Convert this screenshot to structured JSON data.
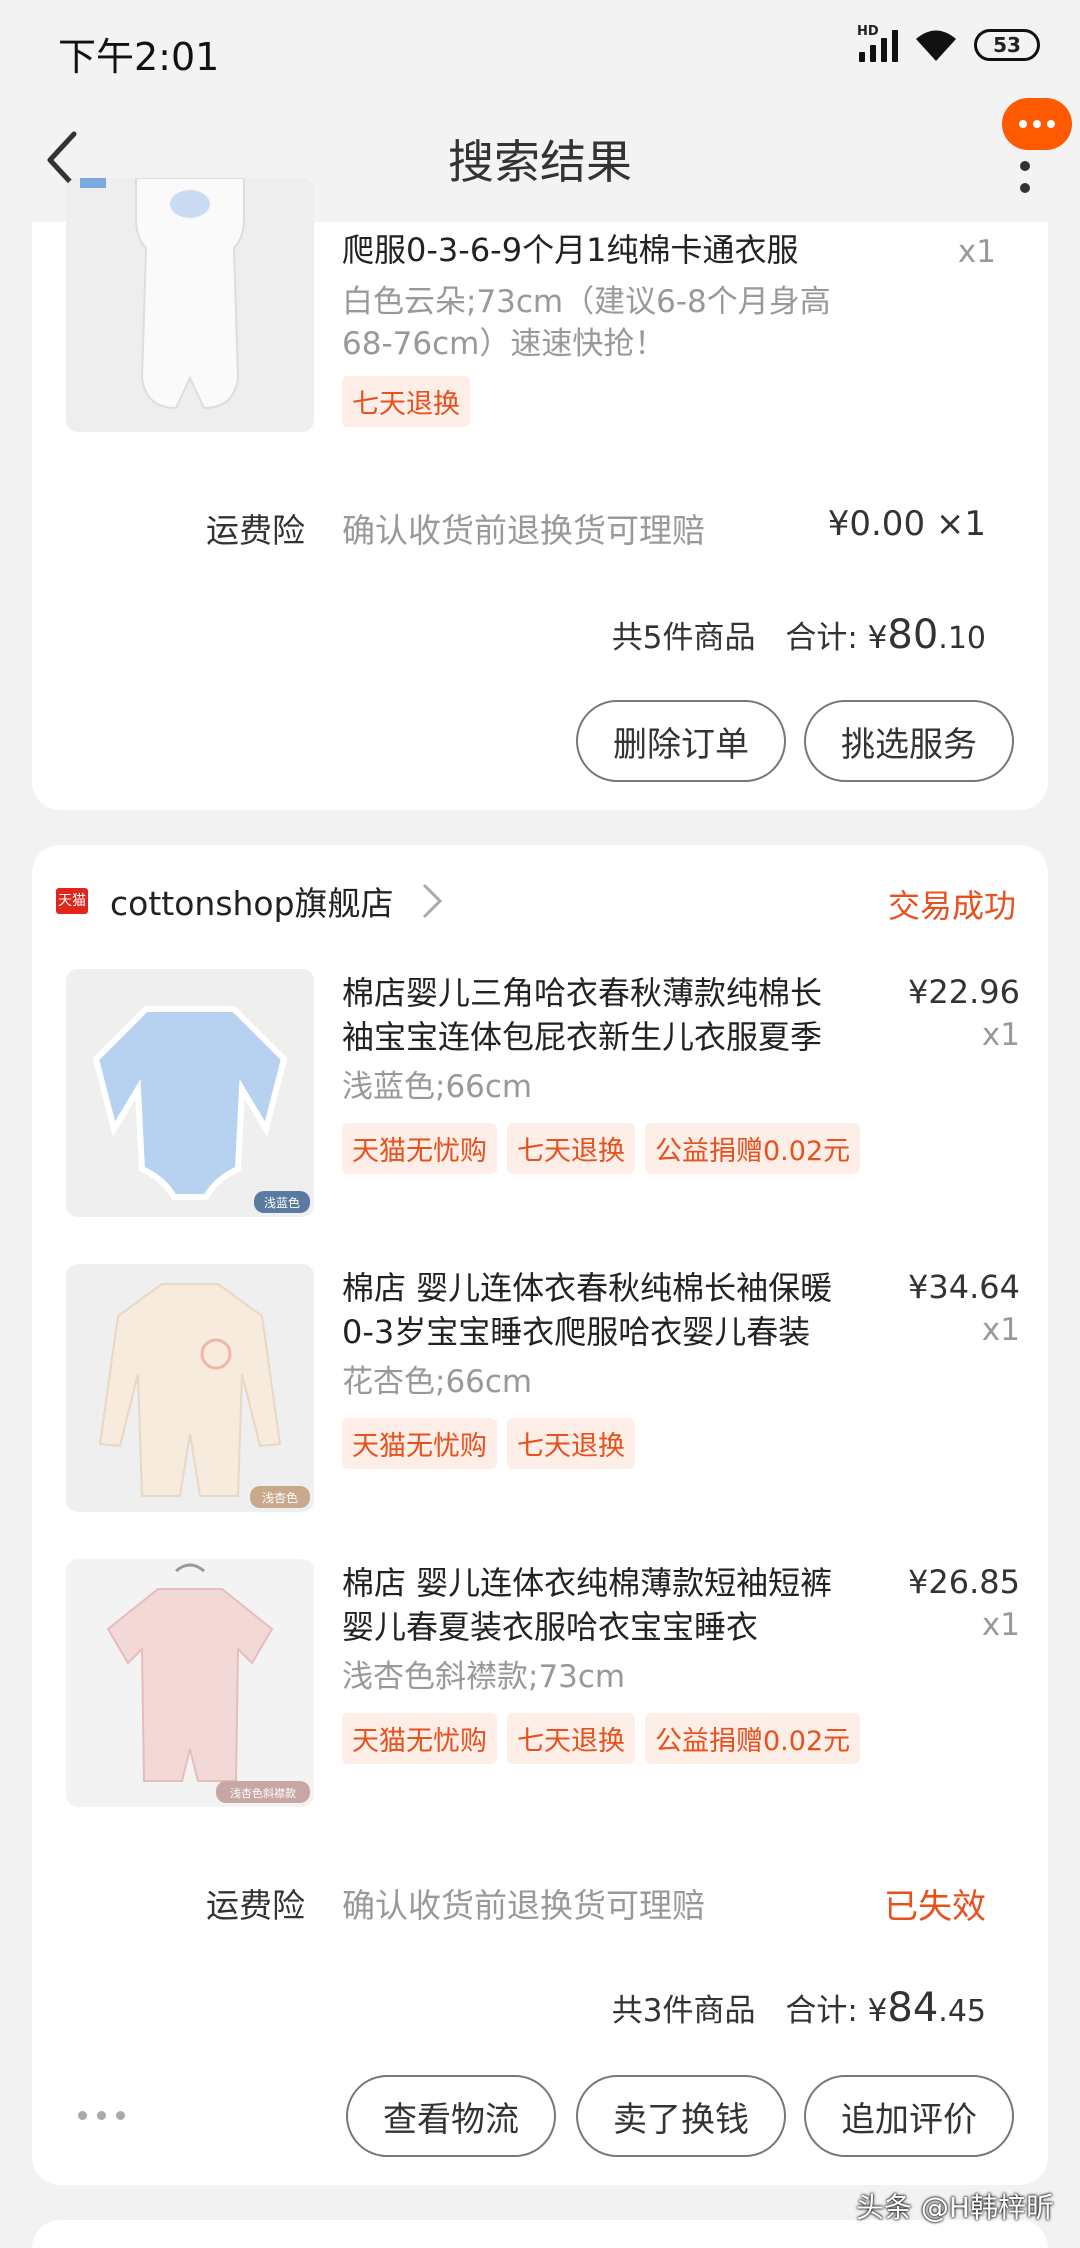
{
  "status_bar": {
    "time": "下午2:01",
    "battery": "53",
    "network": "HD"
  },
  "nav": {
    "title": "搜索结果"
  },
  "order1": {
    "item": {
      "title": "爬服0-3-6-9个月1纯棉卡通衣服",
      "spec_line1": "白色云朵;73cm（建议6-8个月身高",
      "spec_line2": "68-76cm）速速快抢！",
      "qty": "x1",
      "tags": [
        "七天退换"
      ]
    },
    "insurance": {
      "label": "运费险",
      "desc": "确认收货前退换货可理赔",
      "value": "¥0.00 ×1"
    },
    "summary": {
      "count": "共5件商品",
      "total_label": "合计:",
      "currency": "¥",
      "integer": "80",
      "decimal": ".10"
    },
    "buttons": [
      "删除订单",
      "挑选服务"
    ]
  },
  "order2": {
    "shop": {
      "badge": "天猫",
      "name": "cottonshop旗舰店",
      "status": "交易成功"
    },
    "items": [
      {
        "title_line1": "棉店婴儿三角哈衣春秋薄款纯棉长",
        "title_line2": "袖宝宝连体包屁衣新生儿衣服夏季",
        "spec": "浅蓝色;66cm",
        "price": "¥22.96",
        "qty": "x1",
        "tags": [
          "天猫无忧购",
          "七天退换",
          "公益捐赠0.02元"
        ],
        "thumb_label": "浅蓝色",
        "color": "#a9c8ee"
      },
      {
        "title_line1": "棉店 婴儿连体衣春秋纯棉长袖保暖",
        "title_line2": "0-3岁宝宝睡衣爬服哈衣婴儿春装",
        "spec": "花杏色;66cm",
        "price": "¥34.64",
        "qty": "x1",
        "tags": [
          "天猫无忧购",
          "七天退换"
        ],
        "thumb_label": "浅杏色",
        "color": "#f3e3d3"
      },
      {
        "title_line1": "棉店 婴儿连体衣纯棉薄款短袖短裤",
        "title_line2": "婴儿春夏装衣服哈衣宝宝睡衣",
        "spec": "浅杏色斜襟款;73cm",
        "price": "¥26.85",
        "qty": "x1",
        "tags": [
          "天猫无忧购",
          "七天退换",
          "公益捐赠0.02元"
        ],
        "thumb_label": "浅杏色斜襟款",
        "color": "#f1d6d4"
      }
    ],
    "insurance": {
      "label": "运费险",
      "desc": "确认收货前退换货可理赔",
      "value": "已失效"
    },
    "summary": {
      "count": "共3件商品",
      "total_label": "合计:",
      "currency": "¥",
      "integer": "84",
      "decimal": ".45"
    },
    "buttons": [
      "查看物流",
      "卖了换钱",
      "追加评价"
    ]
  },
  "watermark": "头条 @H韩梓昕",
  "colors": {
    "accent": "#e8501e",
    "tag_bg": "#fdeee7",
    "more_bubble": "#ff5a00"
  }
}
